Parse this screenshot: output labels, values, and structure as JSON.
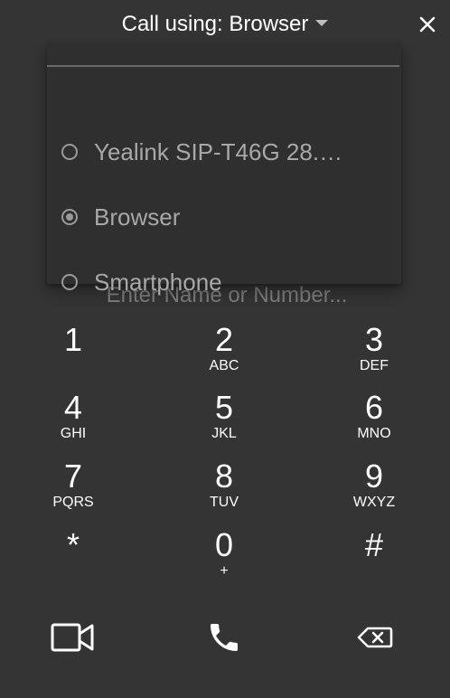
{
  "header": {
    "call_using_label": "Call using: Browser"
  },
  "dropdown": {
    "options": [
      {
        "label": "Yealink SIP-T46G 28.…",
        "selected": false
      },
      {
        "label": "Browser",
        "selected": true
      },
      {
        "label": "Smartphone",
        "selected": false
      }
    ]
  },
  "input": {
    "placeholder": "Enter Name or Number...",
    "value": ""
  },
  "keypad": {
    "keys": [
      {
        "digit": "1",
        "letters": ""
      },
      {
        "digit": "2",
        "letters": "ABC"
      },
      {
        "digit": "3",
        "letters": "DEF"
      },
      {
        "digit": "4",
        "letters": "GHI"
      },
      {
        "digit": "5",
        "letters": "JKL"
      },
      {
        "digit": "6",
        "letters": "MNO"
      },
      {
        "digit": "7",
        "letters": "PQRS"
      },
      {
        "digit": "8",
        "letters": "TUV"
      },
      {
        "digit": "9",
        "letters": "WXYZ"
      },
      {
        "digit": "*",
        "letters": ""
      },
      {
        "digit": "0",
        "letters": "+"
      },
      {
        "digit": "#",
        "letters": ""
      }
    ]
  },
  "actions": {
    "video_icon": "video-camera-icon",
    "call_icon": "phone-icon",
    "backspace_icon": "backspace-icon"
  },
  "colors": {
    "background": "#343434",
    "dropdown_background": "#2f2f2f",
    "text": "#ffffff",
    "muted_text": "#a8a8a8",
    "placeholder": "#7d7d7d"
  }
}
